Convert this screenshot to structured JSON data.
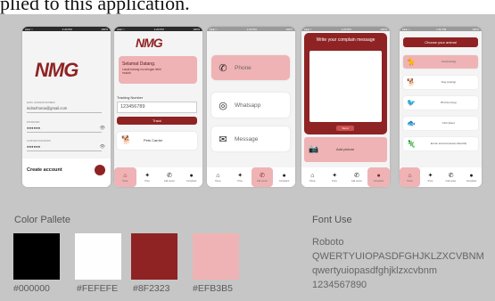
{
  "caption": "plied to this application.",
  "screens": {
    "login": {
      "logo": "NMG",
      "email_label": "EMAIL ADDRESS/NUMBER",
      "email_value": "indrazhoma@gmail.com",
      "password_label": "PASSWORD",
      "password_value": "●●●●●●",
      "confirm_label": "CONFIRM PASSWORD",
      "confirm_value": "●●●●●●",
      "create_account": "Create account"
    },
    "home": {
      "logo": "NMG",
      "welcome_title": "Selamat Datang.",
      "welcome_body": "Lacak barang mu dengan lebih mudah",
      "tracking_label": "Tracking Number",
      "tracking_value": "123456789",
      "track_button": "Track",
      "pets_carrier": "Pets Carrier"
    },
    "contact": {
      "options": [
        {
          "icon": "phone-icon",
          "label": "Phone"
        },
        {
          "icon": "whatsapp-icon",
          "label": "Whatsapp"
        },
        {
          "icon": "message-icon",
          "label": "Message"
        }
      ]
    },
    "complain": {
      "title": "Write your complain message",
      "send_button": "Send",
      "add_picture": "Add picture"
    },
    "animal": {
      "title": "Choose your animal",
      "animals": [
        {
          "icon": "cat-icon",
          "label": "Cat (kucing)"
        },
        {
          "icon": "dog-icon",
          "label": "Dog (anjing)"
        },
        {
          "icon": "bird-icon",
          "label": "Bird (burung)"
        },
        {
          "icon": "fish-icon",
          "label": "Fish (ikan)"
        },
        {
          "icon": "exotic-animal-icon",
          "label": "Exotic animal (Hewan Eksotik)"
        }
      ]
    }
  },
  "nav_items": [
    {
      "icon": "home-icon",
      "label": "Home"
    },
    {
      "icon": "price-tag-icon",
      "label": "Price"
    },
    {
      "icon": "call-center-icon",
      "label": "Call center"
    },
    {
      "icon": "complaint-icon",
      "label": "Complaint"
    }
  ],
  "palette": {
    "title": "Color Pallete",
    "colors": [
      {
        "hex": "#000000",
        "label": "#000000"
      },
      {
        "hex": "#FEFEFE",
        "label": "#FEFEFE"
      },
      {
        "hex": "#8F2323",
        "label": "#8F2323"
      },
      {
        "hex": "#EFB3B5",
        "label": "#EFB3B5"
      }
    ]
  },
  "font_use": {
    "title": "Font Use",
    "name": "Roboto",
    "upper": "QWERTYUIOPASDFGHJKLZXCVBNM",
    "lower": "qwertyuiopasdfghjklzxcvbnm",
    "digits": "1234567890"
  },
  "status_time": "1:20 PM",
  "status_battery": "100%"
}
